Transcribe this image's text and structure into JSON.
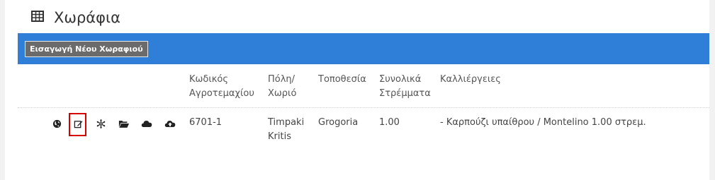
{
  "page": {
    "title": "Χωράφια",
    "title_icon": "table-icon"
  },
  "toolbar": {
    "add_button_label": "Εισαγωγή Νέου Χωραφιού"
  },
  "table": {
    "headers": {
      "code_line1": "Κωδικός",
      "code_line2": "Αγροτεμαχίου",
      "city_line1": "Πόλη/",
      "city_line2": "Χωριό",
      "location": "Τοποθεσία",
      "area_line1": "Συνολικά",
      "area_line2": "Στρέμματα",
      "crops": "Καλλιέργειες"
    },
    "rows": [
      {
        "actions": [
          "globe-icon",
          "edit-icon",
          "snowflake-icon",
          "folder-open-icon",
          "cloud-icon",
          "cloud-upload-icon"
        ],
        "code": "6701-1",
        "city_line1": "Timpaki",
        "city_line2": "Kritis",
        "location": "Grogoria",
        "area": "1.00",
        "crops": "- Καρπούζι υπαίθρου / Montelino 1.00 στρεμ."
      }
    ]
  },
  "colors": {
    "bar": "#2f7fd9",
    "button": "#6b6b6b",
    "highlight": "#d40000"
  }
}
